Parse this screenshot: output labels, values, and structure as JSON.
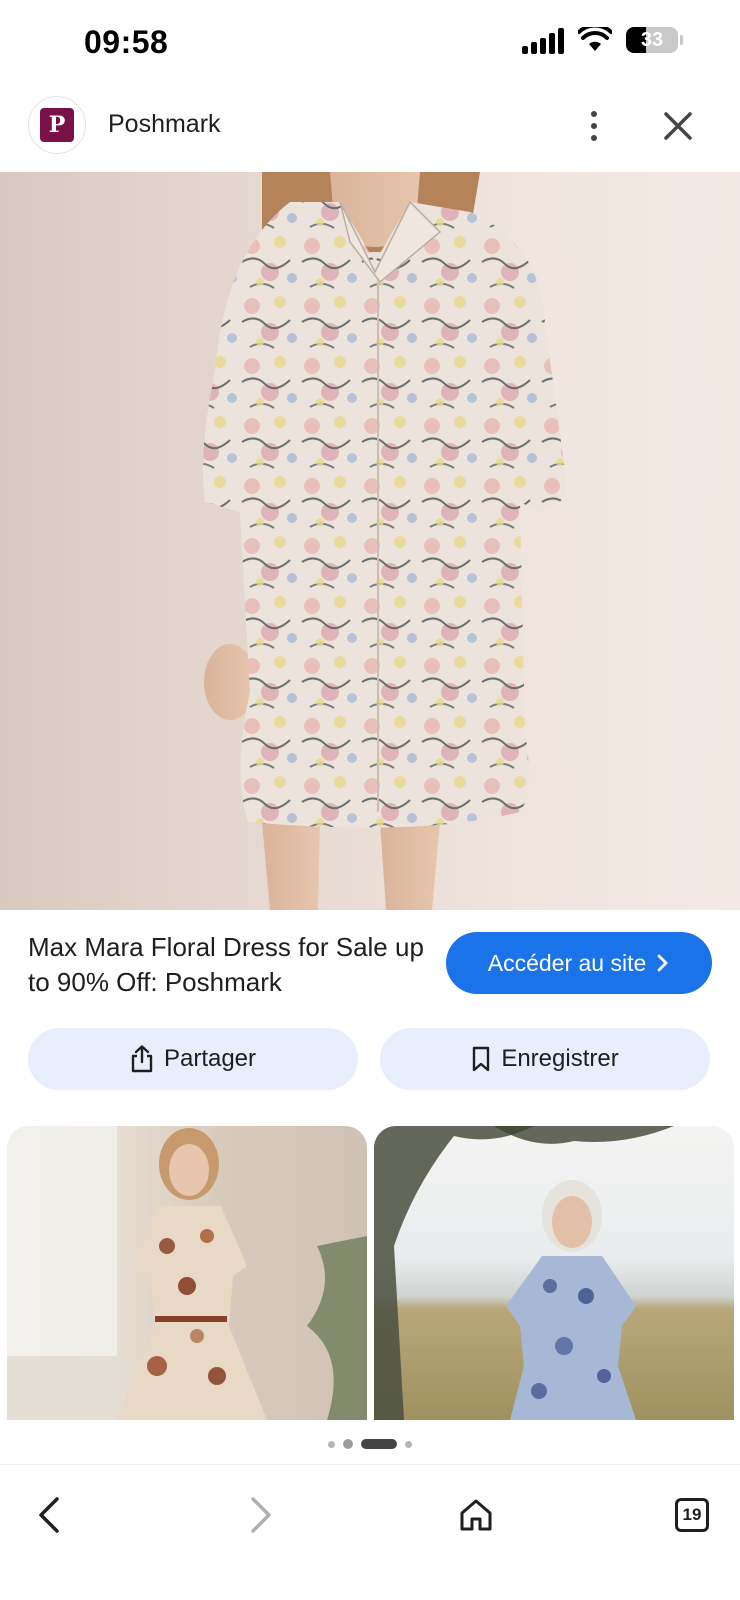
{
  "status_bar": {
    "time": "09:58",
    "battery_percent": "33",
    "icons": [
      "cellular-signal-icon",
      "wifi-icon",
      "battery-icon"
    ]
  },
  "header": {
    "site_name": "Poshmark",
    "logo_icon": "poshmark-logo-icon",
    "brand_color": "#7a1048"
  },
  "result": {
    "title": "Max Mara Floral Dress for Sale up to 90% Off: Poshmark",
    "visit_label": "Accéder au site",
    "share_label": "Partager",
    "save_label": "Enregistrer",
    "accent_color": "#1a73e8"
  },
  "related_images": [
    {
      "icon": "related-image-floral-dress-beige"
    },
    {
      "icon": "related-image-floral-dress-blue"
    }
  ],
  "pager": {
    "total": 4,
    "active_index": 2
  },
  "bottom_nav": {
    "tab_count": "19",
    "icons": [
      "back-arrow-icon",
      "forward-arrow-icon",
      "home-icon",
      "tabs-icon"
    ]
  }
}
